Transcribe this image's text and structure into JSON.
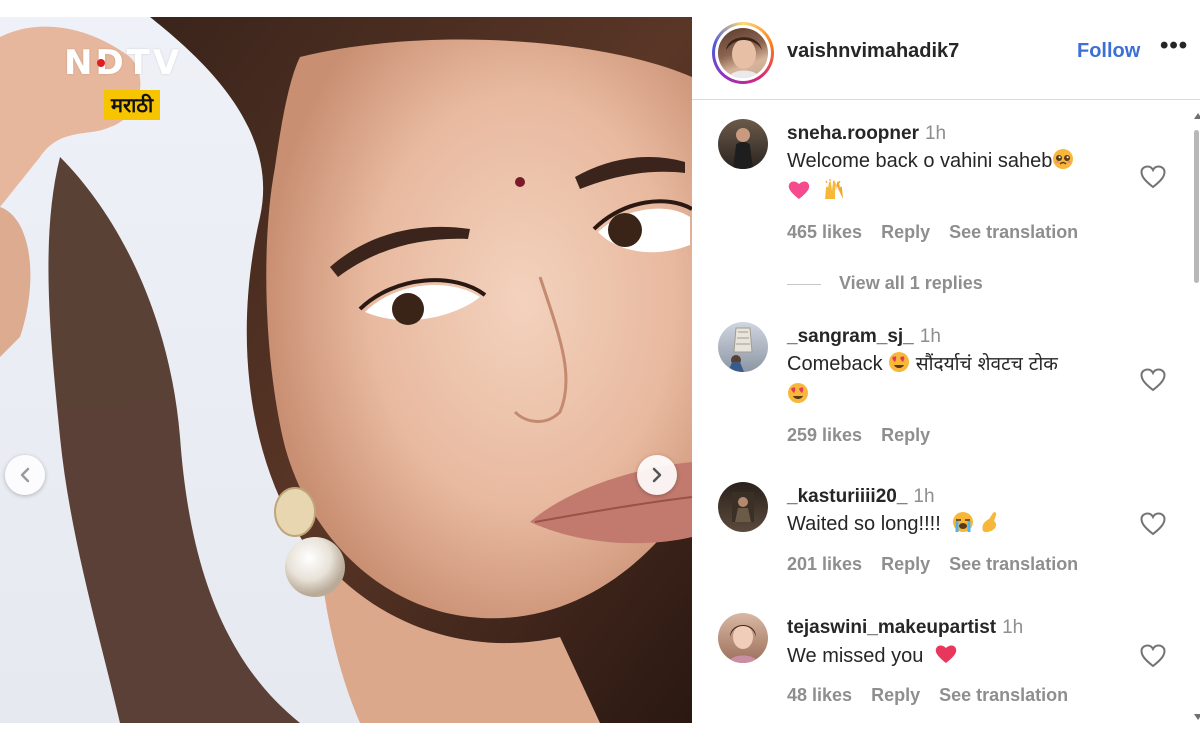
{
  "logo": {
    "brand": "NDTV",
    "edition": "मराठी"
  },
  "post": {
    "username": "vaishnvimahadik7",
    "follow_label": "Follow",
    "more_label": "•••"
  },
  "comments": [
    {
      "user": "sneha.roopner",
      "time": "1h",
      "text": "Welcome back o vahini saheb",
      "emojis": [
        "pleading-face",
        "pink-heart",
        "raising-hands"
      ],
      "likes": "465 likes",
      "reply_label": "Reply",
      "translation_label": "See translation",
      "view_replies": "View all 1 replies"
    },
    {
      "user": "_sangram_sj_",
      "time": "1h",
      "text": "Comeback",
      "text2": "सौंदर्याचं शेवटच टोक",
      "emojis": [
        "heart-eyes",
        "heart-eyes"
      ],
      "likes": "259 likes",
      "reply_label": "Reply"
    },
    {
      "user": "_kasturiiii20_",
      "time": "1h",
      "text": "Waited so long!!!!",
      "emojis": [
        "loudly-crying-face",
        "pinched-fingers"
      ],
      "likes": "201 likes",
      "reply_label": "Reply",
      "translation_label": "See translation"
    },
    {
      "user": "tejaswini_makeupartist",
      "time": "1h",
      "text": "We missed you",
      "emojis": [
        "red-heart"
      ],
      "likes": "48 likes",
      "reply_label": "Reply",
      "translation_label": "See translation"
    }
  ],
  "colors": {
    "follow": "#3d6fd6",
    "muted": "#8e8e8e",
    "text": "#262626",
    "logo_badge": "#f7c400",
    "heart_emoji": "#e8365d"
  }
}
